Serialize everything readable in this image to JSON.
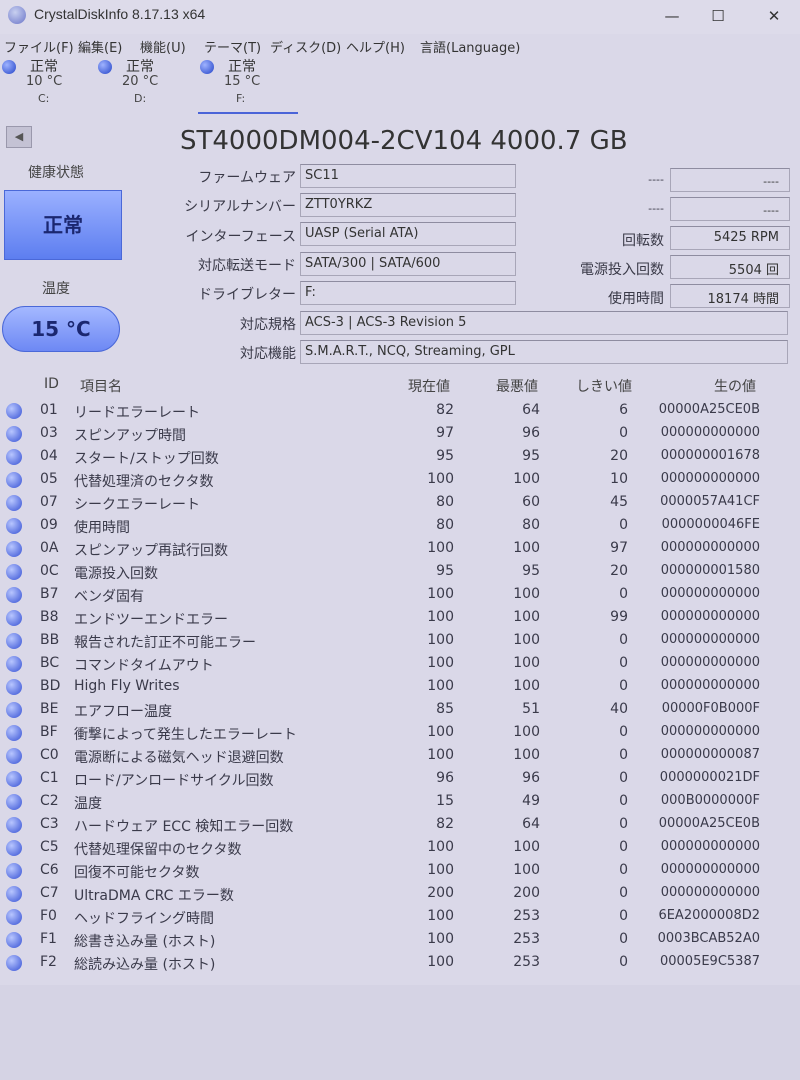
{
  "window": {
    "title": "CrystalDiskInfo 8.17.13 x64",
    "minimize": "—",
    "maximize": "☐",
    "close": "✕"
  },
  "menu": [
    "ファイル(F)",
    "編集(E)",
    "機能(U)",
    "テーマ(T)",
    "ディスク(D)",
    "ヘルプ(H)",
    "言語(Language)"
  ],
  "drives": [
    {
      "status": "正常",
      "temp": "10 °C",
      "letter": "C:"
    },
    {
      "status": "正常",
      "temp": "20 °C",
      "letter": "D:"
    },
    {
      "status": "正常",
      "temp": "15 °C",
      "letter": "F:"
    }
  ],
  "model": "ST4000DM004-2CV104 4000.7 GB",
  "health": {
    "label": "健康状態",
    "value": "正常"
  },
  "temperature": {
    "label": "温度",
    "value": "15 °C"
  },
  "info": {
    "firmware_label": "ファームウェア",
    "firmware": "SC11",
    "serial_label": "シリアルナンバー",
    "serial": "ZTT0YRKZ",
    "interface_label": "インターフェース",
    "interface": "UASP (Serial ATA)",
    "transfer_label": "対応転送モード",
    "transfer": "SATA/300 | SATA/600",
    "letter_label": "ドライブレター",
    "letter": "F:",
    "standard_label": "対応規格",
    "standard": "ACS-3 | ACS-3 Revision 5",
    "features_label": "対応機能",
    "features": "S.M.A.R.T., NCQ, Streaming, GPL",
    "blank1_label": "----",
    "blank1": "----",
    "blank2_label": "----",
    "blank2": "----",
    "rotation_label": "回転数",
    "rotation": "5425 RPM",
    "powercount_label": "電源投入回数",
    "powercount": "5504 回",
    "hours_label": "使用時間",
    "hours": "18174 時間"
  },
  "smart_headers": {
    "id": "ID",
    "name": "項目名",
    "current": "現在値",
    "worst": "最悪値",
    "threshold": "しきい値",
    "raw": "生の値"
  },
  "smart": [
    {
      "id": "01",
      "name": "リードエラーレート",
      "current": "82",
      "worst": "64",
      "threshold": "6",
      "raw": "00000A25CE0B"
    },
    {
      "id": "03",
      "name": "スピンアップ時間",
      "current": "97",
      "worst": "96",
      "threshold": "0",
      "raw": "000000000000"
    },
    {
      "id": "04",
      "name": "スタート/ストップ回数",
      "current": "95",
      "worst": "95",
      "threshold": "20",
      "raw": "000000001678"
    },
    {
      "id": "05",
      "name": "代替処理済のセクタ数",
      "current": "100",
      "worst": "100",
      "threshold": "10",
      "raw": "000000000000"
    },
    {
      "id": "07",
      "name": "シークエラーレート",
      "current": "80",
      "worst": "60",
      "threshold": "45",
      "raw": "0000057A41CF"
    },
    {
      "id": "09",
      "name": "使用時間",
      "current": "80",
      "worst": "80",
      "threshold": "0",
      "raw": "0000000046FE"
    },
    {
      "id": "0A",
      "name": "スピンアップ再試行回数",
      "current": "100",
      "worst": "100",
      "threshold": "97",
      "raw": "000000000000"
    },
    {
      "id": "0C",
      "name": "電源投入回数",
      "current": "95",
      "worst": "95",
      "threshold": "20",
      "raw": "000000001580"
    },
    {
      "id": "B7",
      "name": "ベンダ固有",
      "current": "100",
      "worst": "100",
      "threshold": "0",
      "raw": "000000000000"
    },
    {
      "id": "B8",
      "name": "エンドツーエンドエラー",
      "current": "100",
      "worst": "100",
      "threshold": "99",
      "raw": "000000000000"
    },
    {
      "id": "BB",
      "name": "報告された訂正不可能エラー",
      "current": "100",
      "worst": "100",
      "threshold": "0",
      "raw": "000000000000"
    },
    {
      "id": "BC",
      "name": "コマンドタイムアウト",
      "current": "100",
      "worst": "100",
      "threshold": "0",
      "raw": "000000000000"
    },
    {
      "id": "BD",
      "name": "High Fly Writes",
      "current": "100",
      "worst": "100",
      "threshold": "0",
      "raw": "000000000000"
    },
    {
      "id": "BE",
      "name": "エアフロー温度",
      "current": "85",
      "worst": "51",
      "threshold": "40",
      "raw": "00000F0B000F"
    },
    {
      "id": "BF",
      "name": "衝撃によって発生したエラーレート",
      "current": "100",
      "worst": "100",
      "threshold": "0",
      "raw": "000000000000"
    },
    {
      "id": "C0",
      "name": "電源断による磁気ヘッド退避回数",
      "current": "100",
      "worst": "100",
      "threshold": "0",
      "raw": "000000000087"
    },
    {
      "id": "C1",
      "name": "ロード/アンロードサイクル回数",
      "current": "96",
      "worst": "96",
      "threshold": "0",
      "raw": "0000000021DF"
    },
    {
      "id": "C2",
      "name": "温度",
      "current": "15",
      "worst": "49",
      "threshold": "0",
      "raw": "000B0000000F"
    },
    {
      "id": "C3",
      "name": "ハードウェア ECC 検知エラー回数",
      "current": "82",
      "worst": "64",
      "threshold": "0",
      "raw": "00000A25CE0B"
    },
    {
      "id": "C5",
      "name": "代替処理保留中のセクタ数",
      "current": "100",
      "worst": "100",
      "threshold": "0",
      "raw": "000000000000"
    },
    {
      "id": "C6",
      "name": "回復不可能セクタ数",
      "current": "100",
      "worst": "100",
      "threshold": "0",
      "raw": "000000000000"
    },
    {
      "id": "C7",
      "name": "UltraDMA CRC エラー数",
      "current": "200",
      "worst": "200",
      "threshold": "0",
      "raw": "000000000000"
    },
    {
      "id": "F0",
      "name": "ヘッドフライング時間",
      "current": "100",
      "worst": "253",
      "threshold": "0",
      "raw": "6EA2000008D2"
    },
    {
      "id": "F1",
      "name": "総書き込み量 (ホスト)",
      "current": "100",
      "worst": "253",
      "threshold": "0",
      "raw": "0003BCAB52A0"
    },
    {
      "id": "F2",
      "name": "総読み込み量 (ホスト)",
      "current": "100",
      "worst": "253",
      "threshold": "0",
      "raw": "00005E9C5387"
    }
  ]
}
